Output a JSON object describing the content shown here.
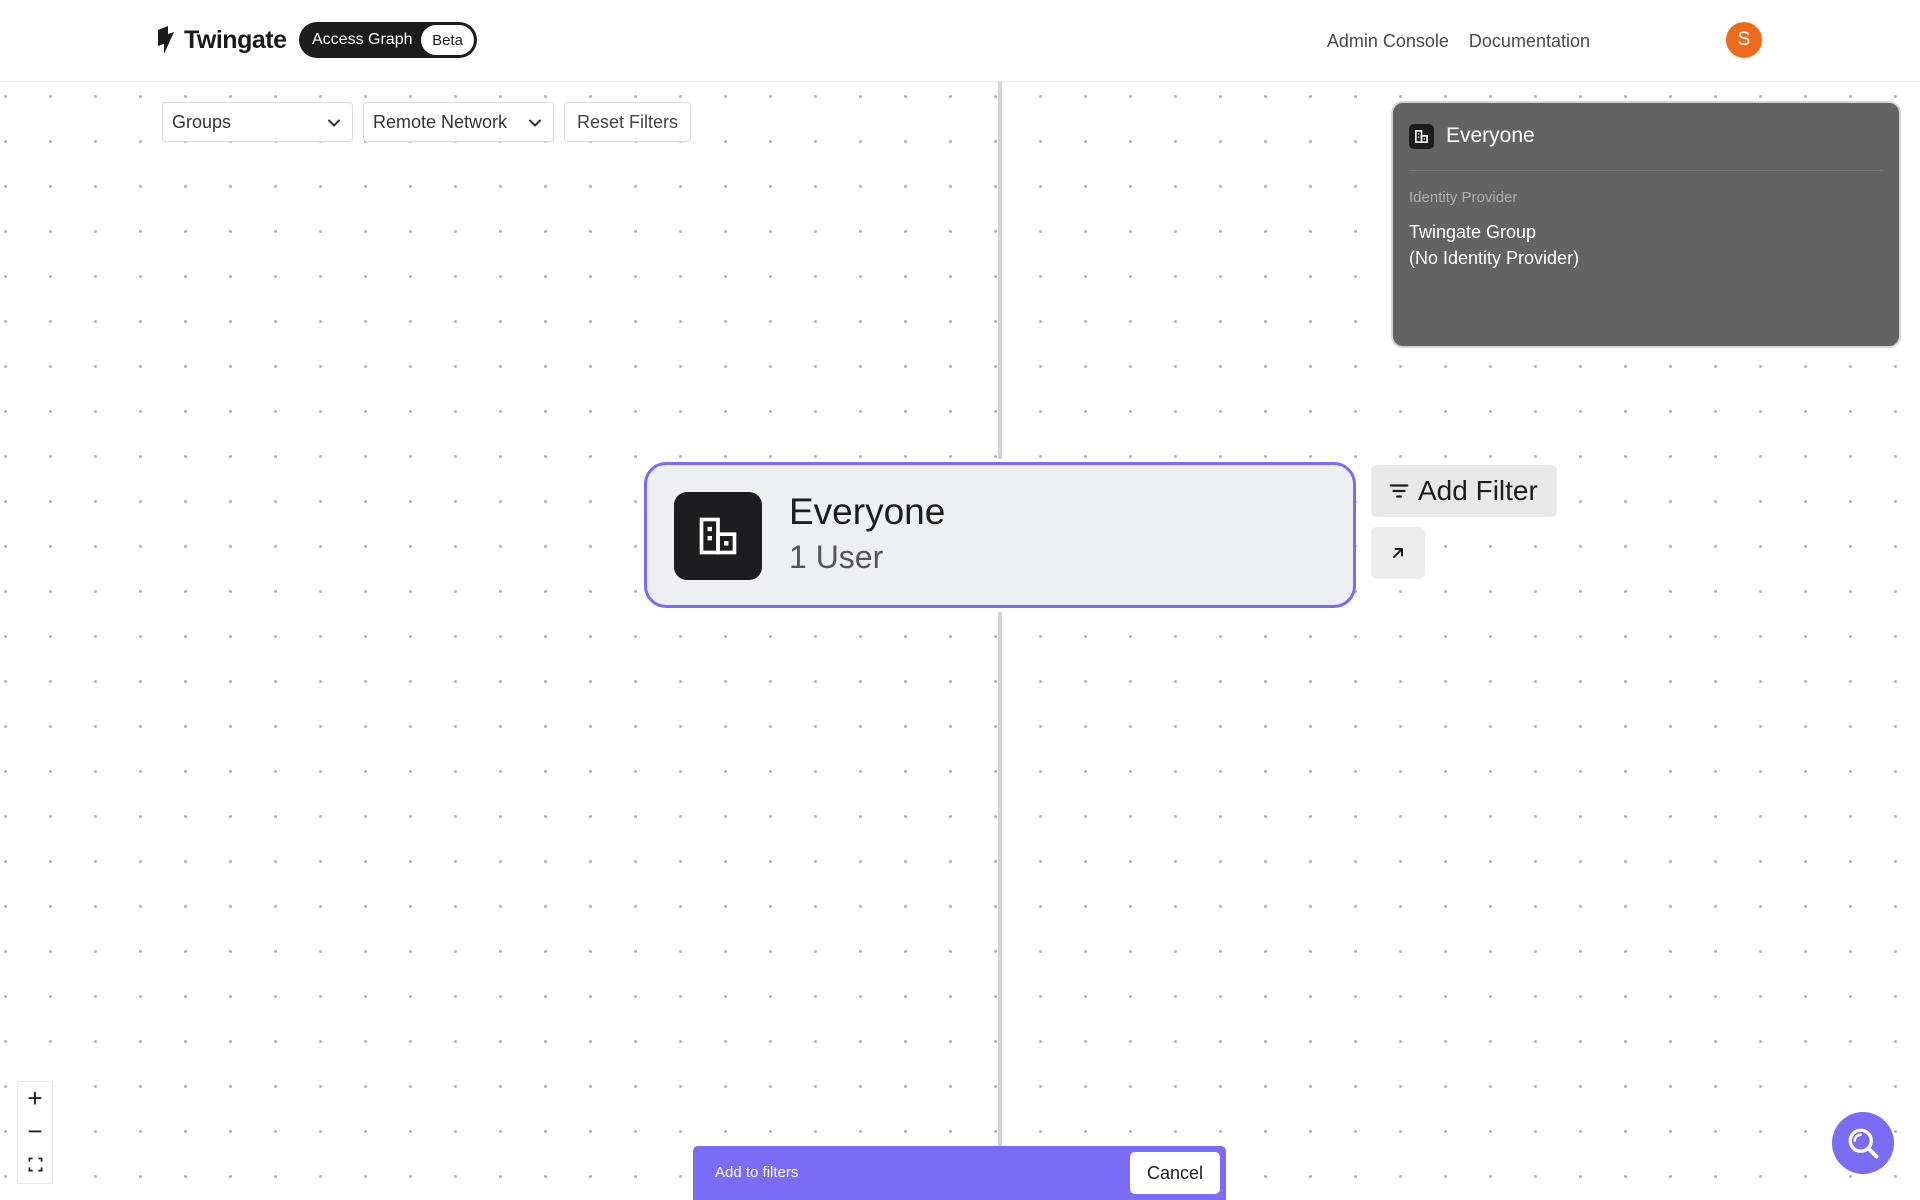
{
  "header": {
    "brand": "Twingate",
    "app_name": "Access Graph",
    "app_badge": "Beta",
    "nav": {
      "admin_console": "Admin Console",
      "documentation": "Documentation"
    },
    "avatar_initial": "S"
  },
  "filters": {
    "groups_select": "Groups",
    "remote_network_select": "Remote Network",
    "reset_label": "Reset Filters"
  },
  "info_panel": {
    "title": "Everyone",
    "field_label": "Identity Provider",
    "field_value_line1": "Twingate Group",
    "field_value_line2": "(No Identity Provider)"
  },
  "node": {
    "title": "Everyone",
    "subtitle": "1 User",
    "icon": "building-icon"
  },
  "actions": {
    "add_filter_label": "Add Filter",
    "add_filter_icon": "filter-icon",
    "open_icon": "arrow-up-right-icon"
  },
  "zoom_controls": {
    "zoom_in": "+",
    "zoom_out": "−",
    "fit_icon": "fit-screen-icon"
  },
  "bottom_bar": {
    "text": "Add to filters",
    "cancel_label": "Cancel"
  },
  "search_fab": {
    "icon": "search-icon"
  },
  "colors": {
    "accent": "#7a6cf5",
    "avatar_bg": "#ee6b1d",
    "panel_bg": "#636363",
    "dark": "#1d1d1f"
  }
}
